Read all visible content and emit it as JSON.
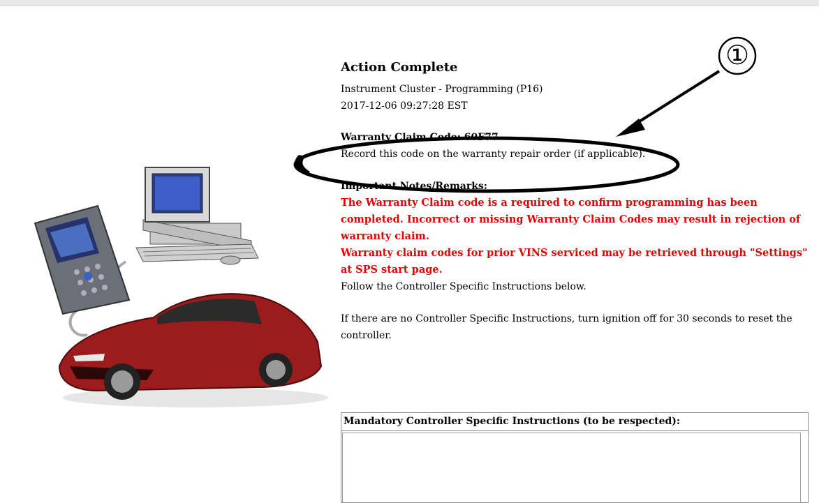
{
  "header": {
    "title": "Action Complete",
    "module": "Instrument Cluster - Programming (P16)",
    "timestamp": "2017-12-06 09:27:28 EST"
  },
  "warranty": {
    "code_line": "Warranty Claim Code: 60F77",
    "instruction": "Record this code on the warranty repair order (if applicable)."
  },
  "annotation": {
    "callout_number": "①"
  },
  "notes": {
    "heading": "Important Notes/Remarks:",
    "warning_1": "The Warranty Claim code is a required to confirm programming has been completed. Incorrect or missing Warranty Claim Codes may result in rejection of warranty claim.",
    "warning_2": "Warranty claim codes for prior VINS serviced may be retrieved through \"Settings\" at SPS start page.",
    "follow": "Follow the Controller Specific Instructions below.",
    "reset": "If there are no Controller Specific Instructions, turn ignition off for 30 seconds to reset the controller."
  },
  "instructions_panel": {
    "header": "Mandatory Controller Specific Instructions (to be respected):",
    "body": ""
  },
  "colors": {
    "warning_red": "#e60000",
    "car_red": "#9c1b1d"
  },
  "illustration": {
    "items": [
      "scan-tool-icon",
      "desktop-computer-icon",
      "sports-car-icon"
    ]
  }
}
